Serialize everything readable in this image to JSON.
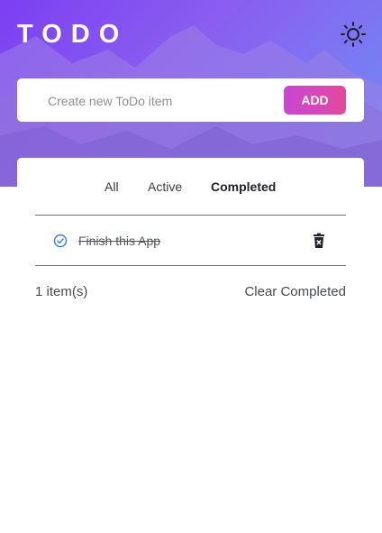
{
  "app": {
    "title": "TODO"
  },
  "header": {
    "theme_icon": "sun-icon"
  },
  "new_item": {
    "placeholder": "Create new ToDo item",
    "value": "",
    "add_label": "ADD"
  },
  "filters": {
    "tabs": [
      "All",
      "Active",
      "Completed"
    ],
    "selected": "Completed"
  },
  "todos": [
    {
      "text": "Finish this App",
      "completed": true
    }
  ],
  "footer": {
    "count_text": "1 item(s)",
    "clear_label": "Clear Completed"
  },
  "colors": {
    "accent_start": "#c846d6",
    "accent_end": "#e5489c",
    "check": "#3b7be0"
  }
}
